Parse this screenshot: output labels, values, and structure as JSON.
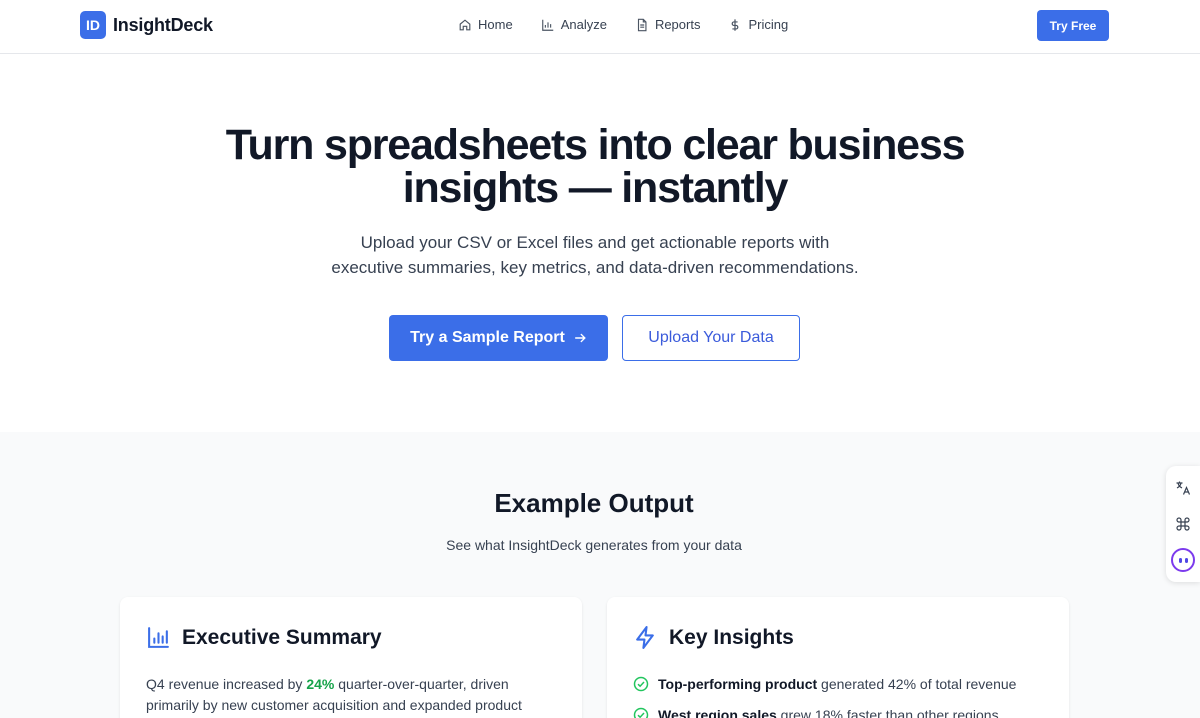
{
  "brand": {
    "logo_text": "ID",
    "name": "InsightDeck"
  },
  "nav": [
    {
      "label": "Home",
      "icon": "home-icon"
    },
    {
      "label": "Analyze",
      "icon": "bar-chart-icon"
    },
    {
      "label": "Reports",
      "icon": "document-icon"
    },
    {
      "label": "Pricing",
      "icon": "dollar-icon"
    }
  ],
  "header": {
    "cta_label": "Try Free"
  },
  "hero": {
    "title": "Turn spreadsheets into clear business insights — instantly",
    "subtitle_line1": "Upload your CSV or Excel files and get actionable reports with",
    "subtitle_line2": "executive summaries, key metrics, and data-driven recommendations.",
    "primary_cta": "Try a Sample Report",
    "secondary_cta": "Upload Your Data"
  },
  "example": {
    "title": "Example Output",
    "subtitle": "See what InsightDeck generates from your data"
  },
  "executive_summary": {
    "title": "Executive Summary",
    "text_before": "Q4 revenue increased by ",
    "highlight": "24%",
    "text_after": " quarter-over-quarter, driven primarily by new customer acquisition and expanded product"
  },
  "key_insights": {
    "title": "Key Insights",
    "items": [
      {
        "bold": "Top-performing product",
        "text": " generated 42% of total revenue"
      },
      {
        "bold": "West region sales",
        "text": " grew 18% faster than other regions"
      }
    ]
  },
  "colors": {
    "accent": "#3b6ee8",
    "highlight": "#16a34a",
    "check": "#22c55e"
  }
}
